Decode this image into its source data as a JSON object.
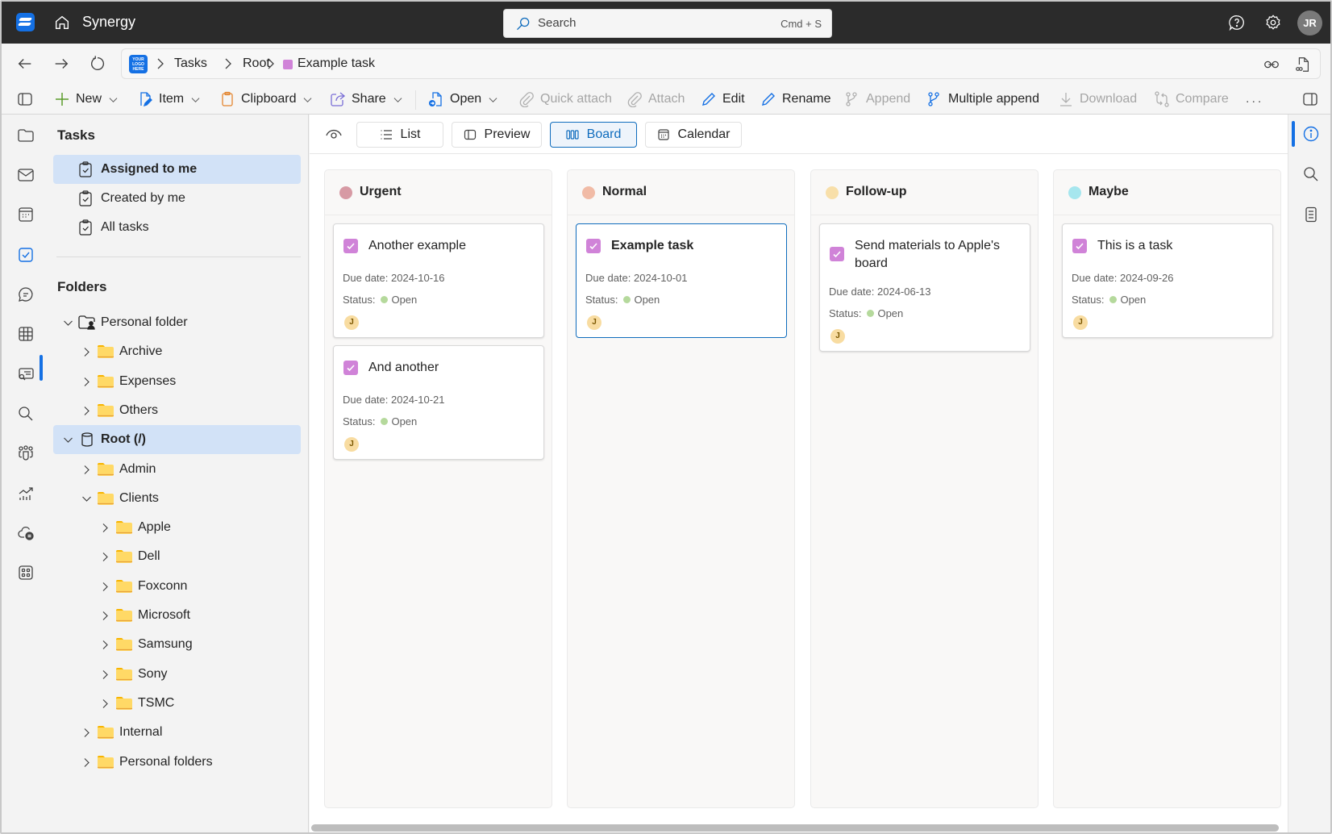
{
  "app": {
    "title": "Synergy",
    "search_placeholder": "Search",
    "search_shortcut": "Cmd + S",
    "user_initials": "JR"
  },
  "breadcrumb": {
    "logo_text": "YOUR LOGO HERE",
    "items": [
      "Tasks",
      "Root",
      "Example task"
    ]
  },
  "toolbar": {
    "items": [
      {
        "label": "New",
        "icon": "plus-icon",
        "dropdown": true,
        "enabled": true
      },
      {
        "label": "Item",
        "icon": "item-edit-icon",
        "dropdown": true,
        "enabled": true
      },
      {
        "label": "Clipboard",
        "icon": "clipboard-icon",
        "dropdown": true,
        "enabled": true
      },
      {
        "label": "Share",
        "icon": "share-icon",
        "dropdown": true,
        "enabled": true
      },
      {
        "label": "Open",
        "icon": "open-document-icon",
        "dropdown": true,
        "enabled": true
      },
      {
        "label": "Quick attach",
        "icon": "paperclip-icon",
        "dropdown": false,
        "enabled": false
      },
      {
        "label": "Attach",
        "icon": "paperclip-icon",
        "dropdown": false,
        "enabled": false
      },
      {
        "label": "Edit",
        "icon": "pencil-icon",
        "dropdown": false,
        "enabled": true
      },
      {
        "label": "Rename",
        "icon": "pencil-icon",
        "dropdown": false,
        "enabled": true
      },
      {
        "label": "Append",
        "icon": "branch-icon",
        "dropdown": false,
        "enabled": false
      },
      {
        "label": "Multiple append",
        "icon": "branch-icon",
        "dropdown": false,
        "enabled": true
      },
      {
        "label": "Download",
        "icon": "download-icon",
        "dropdown": false,
        "enabled": false
      },
      {
        "label": "Compare",
        "icon": "compare-icon",
        "dropdown": false,
        "enabled": false
      }
    ],
    "more_label": "..."
  },
  "sidebar": {
    "tasks_title": "Tasks",
    "task_views": [
      {
        "label": "Assigned to me",
        "selected": true
      },
      {
        "label": "Created by me",
        "selected": false
      },
      {
        "label": "All tasks",
        "selected": false
      }
    ],
    "folders_title": "Folders",
    "tree": [
      {
        "label": "Personal folder",
        "level": 0,
        "expanded": true,
        "type": "personal-folder"
      },
      {
        "label": "Archive",
        "level": 1,
        "expanded": false,
        "type": "folder"
      },
      {
        "label": "Expenses",
        "level": 1,
        "expanded": false,
        "type": "folder"
      },
      {
        "label": "Others",
        "level": 1,
        "expanded": false,
        "type": "folder"
      },
      {
        "label": "Root (/)",
        "level": 0,
        "expanded": true,
        "type": "database",
        "selected": true
      },
      {
        "label": "Admin",
        "level": 1,
        "expanded": false,
        "type": "folder"
      },
      {
        "label": "Clients",
        "level": 1,
        "expanded": true,
        "type": "folder"
      },
      {
        "label": "Apple",
        "level": 2,
        "expanded": false,
        "type": "folder"
      },
      {
        "label": "Dell",
        "level": 2,
        "expanded": false,
        "type": "folder"
      },
      {
        "label": "Foxconn",
        "level": 2,
        "expanded": false,
        "type": "folder"
      },
      {
        "label": "Microsoft",
        "level": 2,
        "expanded": false,
        "type": "folder"
      },
      {
        "label": "Samsung",
        "level": 2,
        "expanded": false,
        "type": "folder"
      },
      {
        "label": "Sony",
        "level": 2,
        "expanded": false,
        "type": "folder"
      },
      {
        "label": "TSMC",
        "level": 2,
        "expanded": false,
        "type": "folder"
      },
      {
        "label": "Internal",
        "level": 1,
        "expanded": false,
        "type": "folder"
      },
      {
        "label": "Personal folders",
        "level": 1,
        "expanded": false,
        "type": "folder"
      }
    ]
  },
  "views": {
    "tabs": [
      {
        "label": "List",
        "active": false
      },
      {
        "label": "Preview",
        "active": false
      },
      {
        "label": "Board",
        "active": true
      },
      {
        "label": "Calendar",
        "active": false
      }
    ]
  },
  "board": {
    "due_prefix": "Due date:",
    "status_prefix": "Status:",
    "columns": [
      {
        "title": "Urgent",
        "color": "#d79aa4",
        "cards": [
          {
            "title": "Another example",
            "due": "2024-10-16",
            "status": "Open",
            "assignee": "J",
            "selected": false
          },
          {
            "title": "And another",
            "due": "2024-10-21",
            "status": "Open",
            "assignee": "J",
            "selected": false
          }
        ]
      },
      {
        "title": "Normal",
        "color": "#f1bba6",
        "cards": [
          {
            "title": "Example task",
            "due": "2024-10-01",
            "status": "Open",
            "assignee": "J",
            "selected": true
          }
        ]
      },
      {
        "title": "Follow-up",
        "color": "#f8dfa9",
        "cards": [
          {
            "title": "Send materials to Apple's board",
            "due": "2024-06-13",
            "status": "Open",
            "assignee": "J",
            "selected": false
          }
        ]
      },
      {
        "title": "Maybe",
        "color": "#a6e6ee",
        "cards": [
          {
            "title": "This is a task",
            "due": "2024-09-26",
            "status": "Open",
            "assignee": "J",
            "selected": false
          }
        ]
      }
    ]
  },
  "colors": {
    "accent": "#0f6cbd",
    "task_checkbox": "#d083d8",
    "status_open": "#b5d99c",
    "folder": "#ffd966",
    "topbar": "#2b2b2b"
  }
}
